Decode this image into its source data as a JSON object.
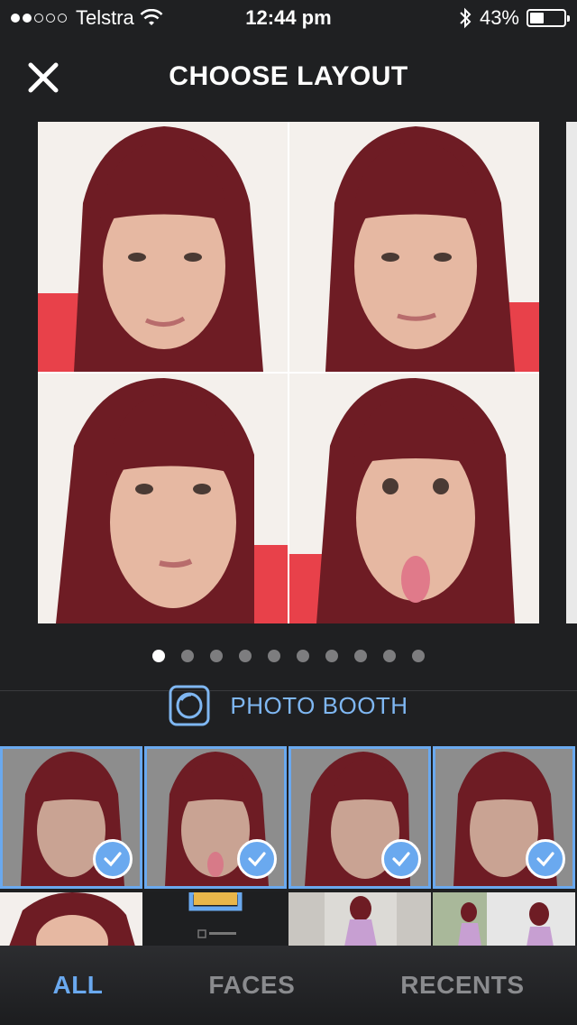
{
  "status_bar": {
    "carrier": "Telstra",
    "time": "12:44 pm",
    "battery_percent": "43%",
    "battery_level": 0.43,
    "signal_bars_filled": 2,
    "signal_bars_total": 5
  },
  "header": {
    "title": "CHOOSE LAYOUT"
  },
  "pager": {
    "total": 10,
    "active_index": 0
  },
  "source": {
    "label": "PHOTO BOOTH"
  },
  "tabs": [
    {
      "label": "ALL",
      "active": true
    },
    {
      "label": "FACES",
      "active": false
    },
    {
      "label": "RECENTS",
      "active": false
    }
  ],
  "colors": {
    "accent": "#6aa9ef",
    "background": "#1f2022",
    "hair": "#6e1c24",
    "skin": "#e6b8a2"
  },
  "selected_count": 4
}
